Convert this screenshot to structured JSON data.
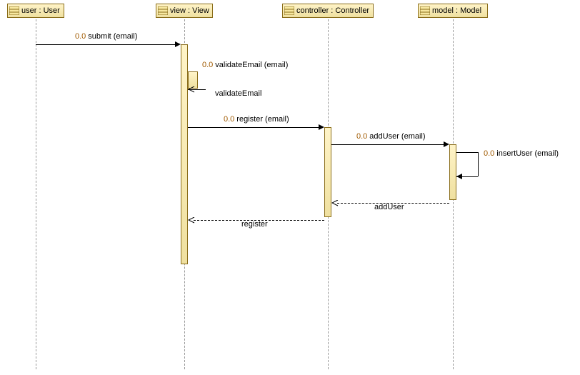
{
  "lifelines": {
    "user": {
      "label": "user : User"
    },
    "view": {
      "label": "view : View"
    },
    "controller": {
      "label": "controller : Controller"
    },
    "model": {
      "label": "model : Model"
    }
  },
  "messages": {
    "submit": {
      "num": "0.0",
      "label": "submit (email)"
    },
    "validateEmail": {
      "num": "0.0",
      "label": "validateEmail (email)"
    },
    "validateEmailRet": {
      "label": "validateEmail"
    },
    "register": {
      "num": "0.0",
      "label": "register (email)"
    },
    "addUser": {
      "num": "0.0",
      "label": "addUser (email)"
    },
    "insertUser": {
      "num": "0.0",
      "label": "insertUser (email)"
    },
    "addUserRet": {
      "label": "addUser"
    },
    "registerRet": {
      "label": "register"
    }
  }
}
